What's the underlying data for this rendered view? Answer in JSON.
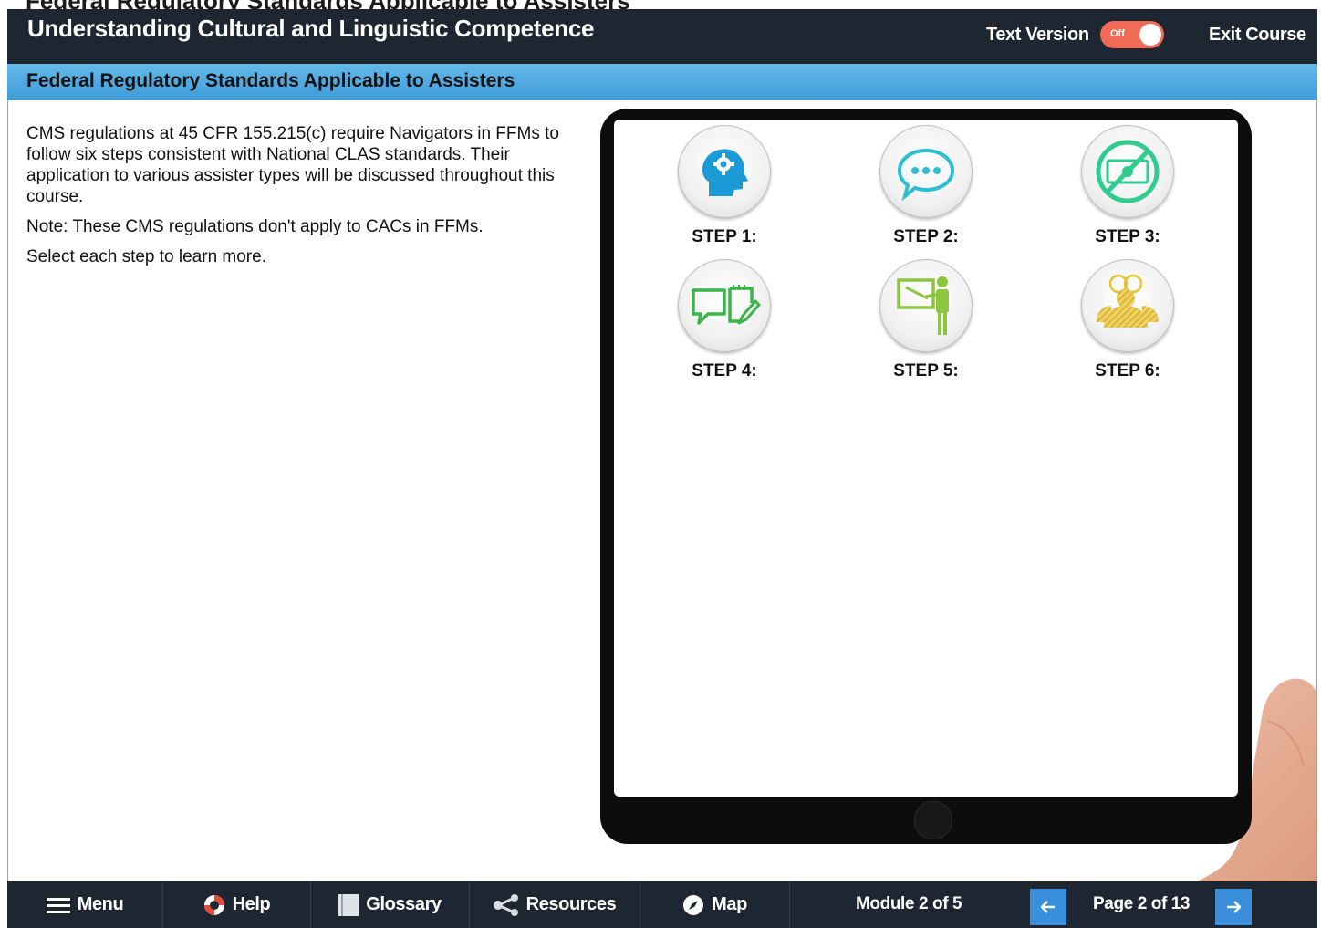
{
  "header": {
    "ghost_title": "Federal Regulatory Standards Applicable to Assisters",
    "course_title": "Understanding Cultural and Linguistic Competence",
    "text_version_label": "Text Version",
    "toggle_state": "Off",
    "exit_label": "Exit Course"
  },
  "page": {
    "title": "Federal Regulatory Standards Applicable to Assisters",
    "paragraphs": [
      "CMS regulations at 45 CFR 155.215(c) require Navigators in FFMs to follow six steps consistent with National CLAS standards. Their application to various assister types will be discussed throughout this course.",
      "Note: These CMS regulations don't apply to CACs in FFMs.",
      "Select each step to learn more."
    ]
  },
  "steps": [
    {
      "label": "STEP 1:",
      "icon": "head-gear-icon",
      "color": "#1b9ad6"
    },
    {
      "label": "STEP 2:",
      "icon": "speech-bubble-icon",
      "color": "#2bbfd0"
    },
    {
      "label": "STEP 3:",
      "icon": "no-money-icon",
      "color": "#2ecc8f"
    },
    {
      "label": "STEP 4:",
      "icon": "speech-notepad-icon",
      "color": "#39b54a"
    },
    {
      "label": "STEP 5:",
      "icon": "teacher-board-icon",
      "color": "#8cc63f"
    },
    {
      "label": "STEP 6:",
      "icon": "people-group-icon",
      "color": "#e8c32e"
    }
  ],
  "footer": {
    "menu_label": "Menu",
    "help_label": "Help",
    "glossary_label": "Glossary",
    "resources_label": "Resources",
    "map_label": "Map",
    "module_text": "Module 2 of 5",
    "page_text": "Page 2 of 13"
  },
  "colors": {
    "topbar": "#1d2631",
    "subbar": "#4aa7e0",
    "toggle": "#f06a56",
    "nav_button": "#3a8fdc"
  }
}
